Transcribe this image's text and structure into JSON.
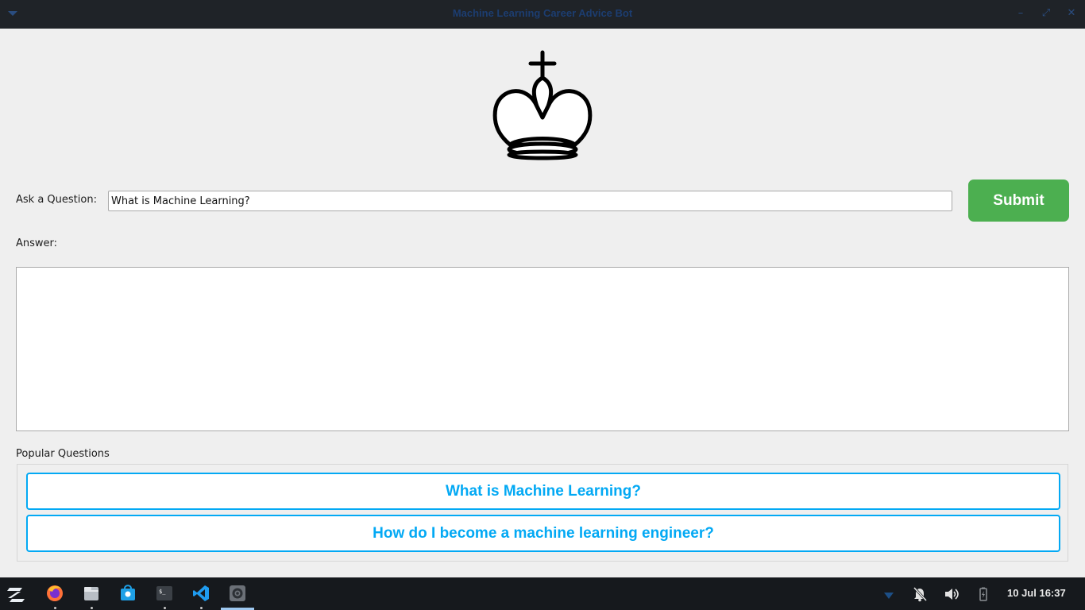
{
  "window": {
    "title": "Machine Learning Career Advice Bot",
    "controls": [
      "minimize",
      "maximize",
      "close"
    ]
  },
  "logo": {
    "icon": "chess-king-icon"
  },
  "question": {
    "label": "Ask a Question:",
    "value": "What is Machine Learning?"
  },
  "submit": {
    "label": "Submit",
    "color": "#4caf50"
  },
  "answer": {
    "label": "Answer:",
    "value": ""
  },
  "popular": {
    "label": "Popular Questions",
    "accent": "#03a9f4",
    "items": [
      {
        "label": "What is Machine Learning?"
      },
      {
        "label": "How do I become a machine learning engineer?"
      }
    ]
  },
  "taskbar": {
    "apps": [
      {
        "name": "zorin-menu-icon"
      },
      {
        "name": "firefox-icon",
        "running": true
      },
      {
        "name": "files-icon",
        "running": true
      },
      {
        "name": "software-store-icon"
      },
      {
        "name": "terminal-icon",
        "running": true
      },
      {
        "name": "vscode-icon",
        "running": true
      },
      {
        "name": "settings-app-icon",
        "active": true
      }
    ],
    "tray": [
      "wifi-icon",
      "notifications-off-icon",
      "volume-icon",
      "battery-icon"
    ],
    "clock": "10 Jul 16:37"
  }
}
